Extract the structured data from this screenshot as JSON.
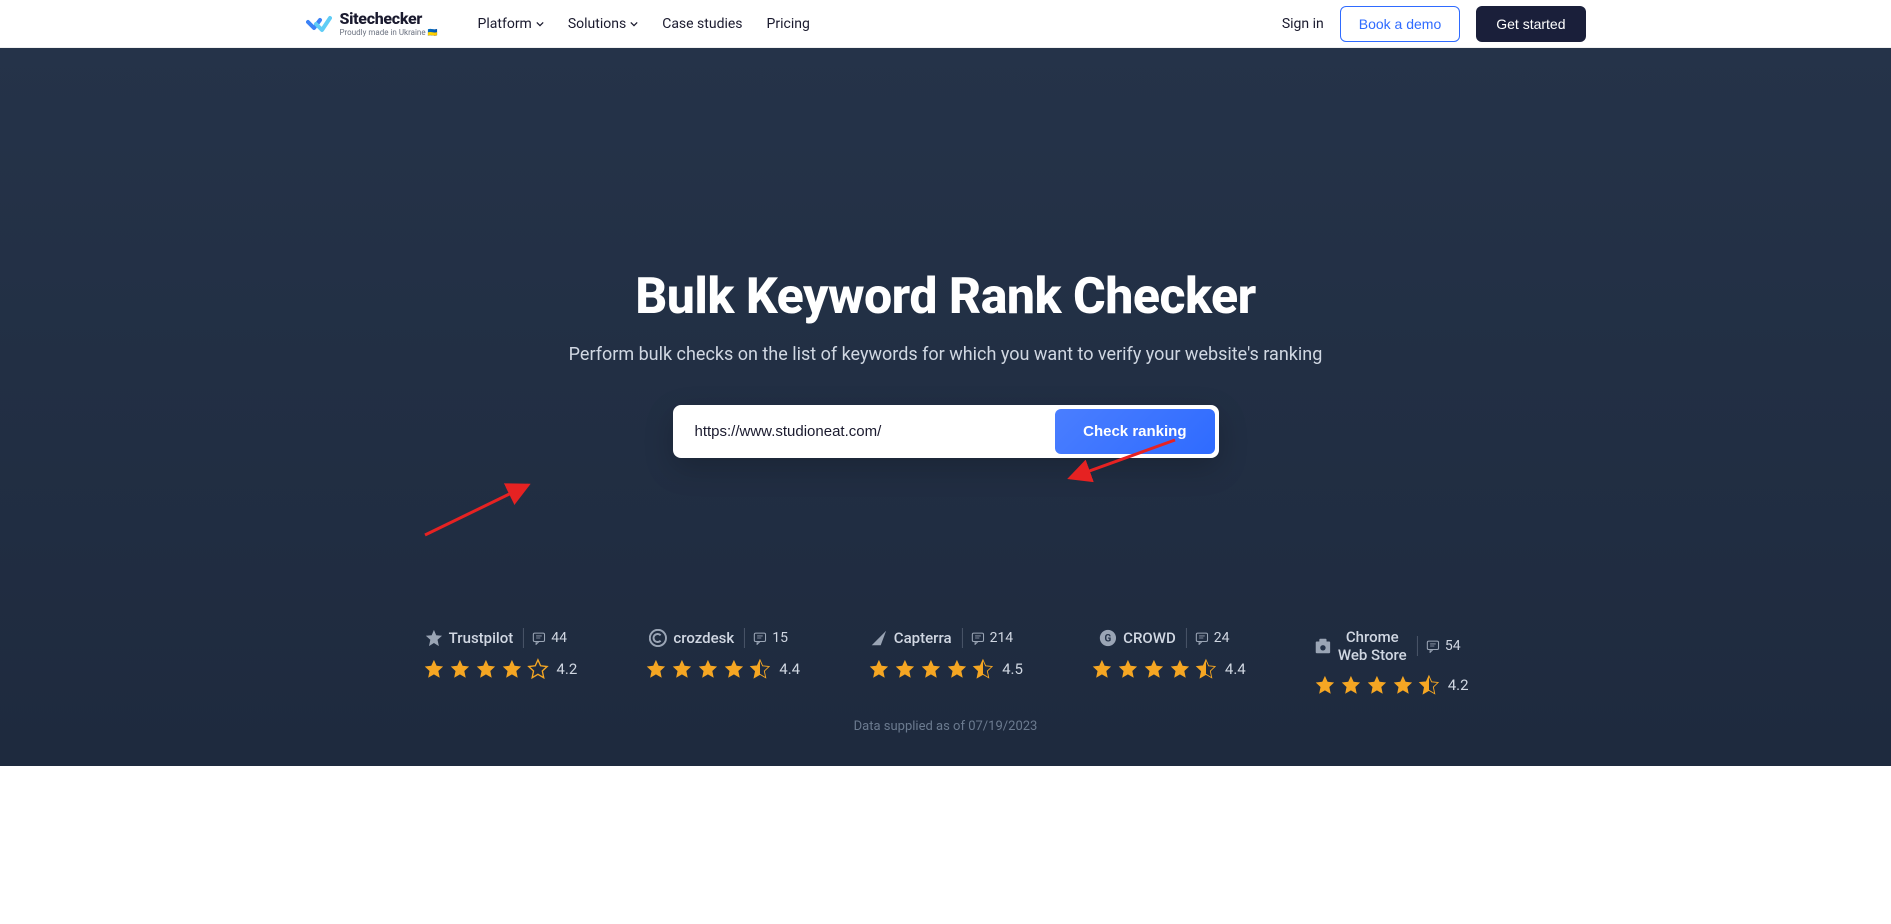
{
  "header": {
    "logo_name": "Sitechecker",
    "logo_sub": "Proudly made in Ukraine 🇺🇦",
    "nav": [
      "Platform",
      "Solutions",
      "Case studies",
      "Pricing"
    ],
    "nav_has_dropdown": [
      true,
      true,
      false,
      false
    ],
    "signin": "Sign in",
    "demo": "Book a demo",
    "getstarted": "Get started"
  },
  "hero": {
    "title": "Bulk Keyword Rank Checker",
    "subtitle": "Perform bulk checks on the list of keywords for which you want to verify your website's ranking",
    "input_value": "https://www.studioneat.com/",
    "button": "Check ranking"
  },
  "reviews": [
    {
      "brand": "Trustpilot",
      "count": "44",
      "rating": "4.2",
      "stars": 4.0
    },
    {
      "brand": "crozdesk",
      "count": "15",
      "rating": "4.4",
      "stars": 4.5
    },
    {
      "brand": "Capterra",
      "count": "214",
      "rating": "4.5",
      "stars": 4.5
    },
    {
      "brand": "CROWD",
      "count": "24",
      "rating": "4.4",
      "stars": 4.5
    },
    {
      "brand": "Chrome Web Store",
      "count": "54",
      "rating": "4.2",
      "stars": 4.5
    }
  ],
  "footer_note": "Data supplied as of 07/19/2023"
}
